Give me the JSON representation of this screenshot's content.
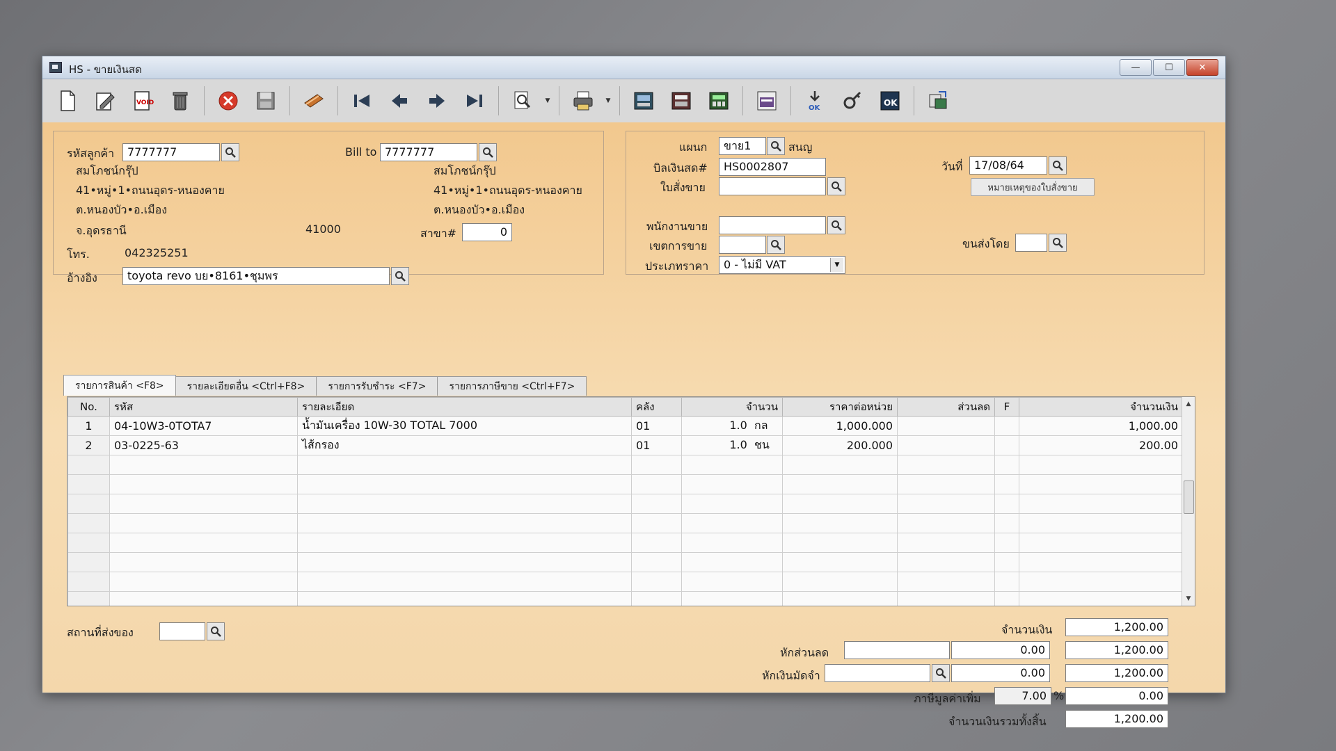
{
  "window": {
    "title": "HS - ขายเงินสด",
    "buttons": {
      "minimize": "—",
      "maximize": "☐",
      "close": "✕"
    }
  },
  "toolbar": {
    "icons": [
      "new-doc-icon",
      "edit-icon",
      "void-icon",
      "trash-icon",
      "cancel-icon",
      "save-icon",
      "notes-icon",
      "first-record-icon",
      "prev-record-icon",
      "next-record-icon",
      "last-record-icon",
      "search-doc-icon",
      "print-icon",
      "report-icon",
      "ledger-icon",
      "calc-icon",
      "renew-icon",
      "approve-icon",
      "key-icon",
      "ok-icon",
      "transfer-icon"
    ]
  },
  "customer": {
    "code_label": "รหัสลูกค้า",
    "code": "7777777",
    "name": "สมโภชน์กรุ๊ป",
    "address1": "41•หมู่•1•ถนนอุดร-หนองคาย",
    "address2": "ต.หนองบัว•อ.เมือง",
    "province": "จ.อุดรธานี",
    "zip": "41000",
    "phone_label": "โทร.",
    "phone": "042325251",
    "ref_label": "อ้างอิง",
    "ref": "toyota revo บย•8161•ชุมพร"
  },
  "billto": {
    "label": "Bill to",
    "code": "7777777",
    "name": "สมโภชน์กรุ๊ป",
    "address1": "41•หมู่•1•ถนนอุดร-หนองคาย",
    "address2": "ต.หนองบัว•อ.เมือง",
    "branch_label": "สาขา#",
    "branch": "0"
  },
  "doc": {
    "dept_label": "แผนก",
    "dept": "ขาย1",
    "dept_name": "สนญ",
    "bill_label": "บิลเงินสด#",
    "bill": "HS0002807",
    "date_label": "วันที่",
    "date": "17/08/64",
    "order_label": "ใบสั่งขาย",
    "order": "",
    "note_button": "หมายเหตุของใบสั่งขาย",
    "salesman_label": "พนักงานขาย",
    "salesman": "",
    "area_label": "เขตการขาย",
    "area": "",
    "ship_label": "ขนส่งโดย",
    "ship": "",
    "price_type_label": "ประเภทราคา",
    "price_type": "0 - ไม่มี VAT"
  },
  "tabs": [
    {
      "label": "รายการสินค้า <F8>"
    },
    {
      "label": "รายละเอียดอื่น <Ctrl+F8>"
    },
    {
      "label": "รายการรับชำระ <F7>"
    },
    {
      "label": "รายการภาษีขาย <Ctrl+F7>"
    }
  ],
  "grid": {
    "headers": {
      "no": "No.",
      "code": "รหัส",
      "desc": "รายละเอียด",
      "wh": "คลัง",
      "qty": "จำนวน",
      "price": "ราคาต่อหน่วย",
      "discount": "ส่วนลด",
      "f": "F",
      "amount": "จำนวนเงิน"
    },
    "rows": [
      {
        "no": "1",
        "code": "04-10W3-0TOTA7",
        "desc": "น้ำมันเครื่อง 10W-30 TOTAL 7000",
        "wh": "01",
        "qty": "1.0",
        "unit": "กล",
        "price": "1,000.000",
        "discount": "",
        "f": "",
        "amount": "1,000.00"
      },
      {
        "no": "2",
        "code": "03-0225-63",
        "desc": "ไส้กรอง",
        "wh": "01",
        "qty": "1.0",
        "unit": "ชน",
        "price": "200.000",
        "discount": "",
        "f": "",
        "amount": "200.00"
      }
    ]
  },
  "footer": {
    "delivery_label": "สถานที่ส่งของ",
    "delivery": "",
    "amount_label": "จำนวนเงิน",
    "amount": "1,200.00",
    "discount_label": "หักส่วนลด",
    "discount_text": "",
    "discount_value": "0.00",
    "discount_total": "1,200.00",
    "deposit_label": "หักเงินมัดจำ",
    "deposit_text": "",
    "deposit_value": "0.00",
    "deposit_total": "1,200.00",
    "vat_label": "ภาษีมูลค่าเพิ่ม",
    "vat_rate": "7.00",
    "vat_pct": "%",
    "vat_amount": "0.00",
    "grand_label": "จำนวนเงินรวมทั้งสิ้น",
    "grand_total": "1,200.00"
  }
}
